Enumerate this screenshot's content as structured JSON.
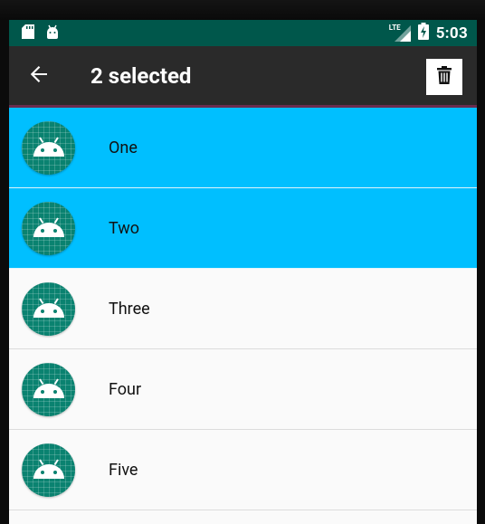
{
  "status_bar": {
    "time": "5:03",
    "network_label": "LTE",
    "left_icons": [
      "sd-card-icon",
      "android-debug-icon"
    ]
  },
  "app_bar": {
    "title": "2 selected",
    "back_icon": "arrow-back-icon",
    "action_icon": "delete-icon"
  },
  "list": {
    "items": [
      {
        "label": "One",
        "selected": true
      },
      {
        "label": "Two",
        "selected": true
      },
      {
        "label": "Three",
        "selected": false
      },
      {
        "label": "Four",
        "selected": false
      },
      {
        "label": "Five",
        "selected": false
      }
    ]
  },
  "colors": {
    "status_bar": "#00574b",
    "app_bar": "#2a2a2a",
    "selected_row": "#00bfff",
    "avatar": "#0a8270"
  }
}
